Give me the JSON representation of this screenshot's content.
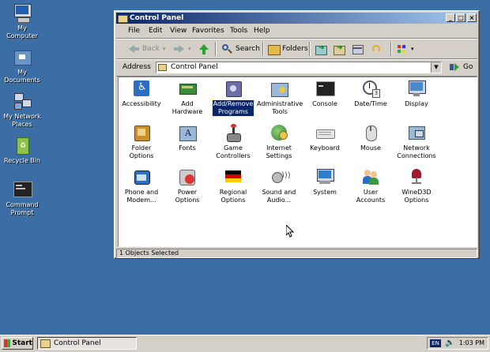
{
  "desktop": {
    "icons": [
      {
        "label": "My\nComputer"
      },
      {
        "label": "My\nDocuments"
      },
      {
        "label": "My Network\nPlaces"
      },
      {
        "label": "Recycle Bin"
      },
      {
        "label": "Command\nPrompt"
      }
    ]
  },
  "window": {
    "title": "Control Panel",
    "controls": {
      "minimize": "_",
      "maximize": "□",
      "close": "×"
    },
    "menu": [
      "File",
      "Edit",
      "View",
      "Favorites",
      "Tools",
      "Help"
    ],
    "toolbar": {
      "back": "Back",
      "search": "Search",
      "folders": "Folders"
    },
    "address": {
      "label": "Address",
      "value": "Control Panel",
      "go": "Go"
    },
    "items": [
      {
        "label": "Accessibility",
        "icon": "accessibility-icon"
      },
      {
        "label": "Add\nHardware",
        "icon": "add-hardware-icon"
      },
      {
        "label": "Add/Remove\nPrograms",
        "icon": "add-remove-programs-icon",
        "selected": true
      },
      {
        "label": "Administrative\nTools",
        "icon": "administrative-tools-icon"
      },
      {
        "label": "Console",
        "icon": "console-icon"
      },
      {
        "label": "Date/Time",
        "icon": "date-time-icon"
      },
      {
        "label": "Display",
        "icon": "display-icon"
      },
      {
        "label": "Folder\nOptions",
        "icon": "folder-options-icon"
      },
      {
        "label": "Fonts",
        "icon": "fonts-icon"
      },
      {
        "label": "Game\nControllers",
        "icon": "game-controllers-icon"
      },
      {
        "label": "Internet\nSettings",
        "icon": "internet-settings-icon"
      },
      {
        "label": "Keyboard",
        "icon": "keyboard-icon"
      },
      {
        "label": "Mouse",
        "icon": "mouse-icon"
      },
      {
        "label": "Network\nConnections",
        "icon": "network-connections-icon"
      },
      {
        "label": "Phone and\nModem...",
        "icon": "phone-modem-icon"
      },
      {
        "label": "Power\nOptions",
        "icon": "power-options-icon"
      },
      {
        "label": "Regional\nOptions",
        "icon": "regional-options-icon"
      },
      {
        "label": "Sound and\nAudio...",
        "icon": "sound-audio-icon"
      },
      {
        "label": "System",
        "icon": "system-icon"
      },
      {
        "label": "User\nAccounts",
        "icon": "user-accounts-icon"
      },
      {
        "label": "WineD3D\nOptions",
        "icon": "wined3d-options-icon"
      }
    ],
    "status": "1 Objects Selected"
  },
  "taskbar": {
    "start": "Start",
    "task": "Control Panel",
    "lang": "EN",
    "clock": "1:03 PM"
  }
}
